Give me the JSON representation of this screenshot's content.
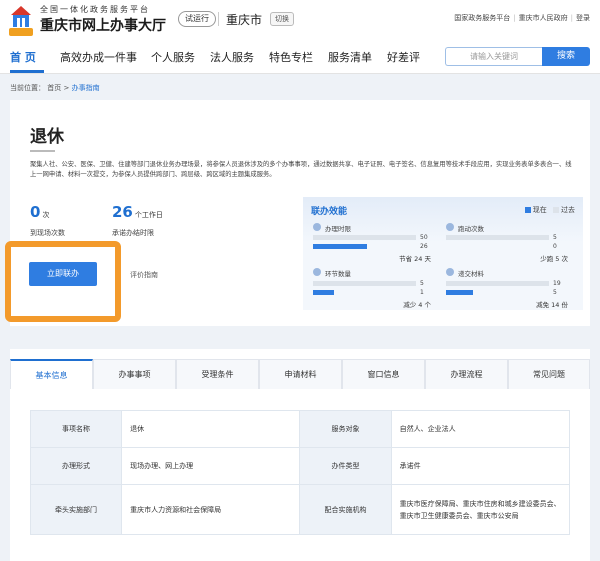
{
  "header": {
    "subtitle": "全国一体化政务服务平台",
    "title": "重庆市网上办事大厅",
    "badge": "试运行",
    "city": "重庆市",
    "switch_label": "切换",
    "links": [
      "国家政务服务平台",
      "重庆市人民政府",
      "登录"
    ],
    "logo_text": "渝快办"
  },
  "nav": {
    "items": [
      "首 页",
      "高效办成一件事",
      "个人服务",
      "法人服务",
      "特色专栏",
      "服务清单",
      "好差评"
    ],
    "search_placeholder": "请输入关键词",
    "search_button": "搜索"
  },
  "breadcrumb": {
    "prefix": "当前位置：",
    "home": "首页",
    "sep": ">",
    "current": "办事指南"
  },
  "card": {
    "title": "退休",
    "description": "聚集人社、公安、医保、卫健、住建等部门退休业务办理场景，将参保人员退休涉及的多个办事事项，通过数据共享、电子证照、电子签名、信息复用等技术手段应用，实现业务表单多表合一、线上一网申请、材料一次提交，为参保人员提供跨部门、跨层级、跨区域的主题集成服务。",
    "visits_value": "0",
    "visits_unit": "次",
    "visits_label": "到现场次数",
    "days_value": "26",
    "days_unit": "个工作日",
    "days_label": "承诺办结时限",
    "join_button": "立即联办",
    "guide_link": "评价指南"
  },
  "efficiency": {
    "title": "联办效能",
    "legend_now": "现在",
    "legend_past": "过去",
    "colors": {
      "now": "#2f7de1",
      "past": "#dde3ea"
    },
    "metrics": [
      {
        "icon": "clock-icon",
        "label": "办理时限",
        "past": 50,
        "now": 26,
        "past_label": "50",
        "now_label": "26",
        "saving": "节省 24 天"
      },
      {
        "icon": "runner-icon",
        "label": "跑动次数",
        "past": 5,
        "now": 0,
        "past_label": "5",
        "now_label": "0",
        "saving": "少跑 5 次"
      },
      {
        "icon": "flow-icon",
        "label": "环节数量",
        "past": 5,
        "now": 1,
        "past_label": "5",
        "now_label": "1",
        "saving": "减少 4 个"
      },
      {
        "icon": "document-icon",
        "label": "递交材料",
        "past": 19,
        "now": 5,
        "past_label": "19",
        "now_label": "5",
        "saving": "减免 14 份"
      }
    ]
  },
  "tabs": [
    "基本信息",
    "办事事项",
    "受理条件",
    "申请材料",
    "窗口信息",
    "办理流程",
    "常见问题"
  ],
  "info": [
    [
      "事项名称",
      "退休",
      "服务对象",
      "自然人、企业法人"
    ],
    [
      "办理形式",
      "现场办理、网上办理",
      "办件类型",
      "承诺件"
    ],
    [
      "牵头实施部门",
      "重庆市人力资源和社会保障局",
      "配合实施机构",
      "重庆市医疗保障局、重庆市住房和城乡建设委员会、重庆市卫生健康委员会、重庆市公安局"
    ]
  ]
}
